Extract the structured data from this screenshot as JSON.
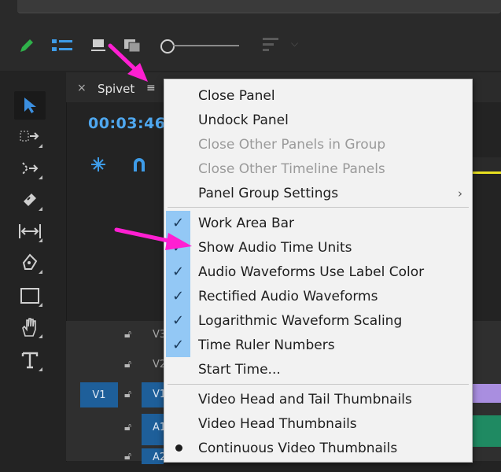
{
  "panel": {
    "tab_label": "Spivet",
    "close_glyph": "×",
    "menu_glyph": "≡",
    "timecode": "00:03:46:"
  },
  "tracks": [
    {
      "name": "V3",
      "selected": false
    },
    {
      "name": "V2",
      "selected": false
    },
    {
      "name": "V1",
      "source_label": "V1",
      "selected": true
    },
    {
      "name": "A1",
      "selected": true
    },
    {
      "name": "A2",
      "selected": true
    }
  ],
  "menu": {
    "items": [
      {
        "label": "Close Panel",
        "enabled": true
      },
      {
        "label": "Undock Panel",
        "enabled": true
      },
      {
        "label": "Close Other Panels in Group",
        "enabled": false
      },
      {
        "label": "Close Other Timeline Panels",
        "enabled": false
      },
      {
        "label": "Panel Group Settings",
        "enabled": true,
        "submenu": true
      },
      {
        "label": "Work Area Bar",
        "checked": true
      },
      {
        "label": "Show Audio Time Units",
        "checked": true
      },
      {
        "label": "Audio Waveforms Use Label Color",
        "checked": true
      },
      {
        "label": "Rectified Audio Waveforms",
        "checked": true
      },
      {
        "label": "Logarithmic Waveform Scaling",
        "checked": true
      },
      {
        "label": "Time Ruler Numbers",
        "checked": true
      },
      {
        "label": "Start Time...",
        "enabled": true
      },
      {
        "label": "Video Head and Tail Thumbnails",
        "enabled": true
      },
      {
        "label": "Video Head Thumbnails",
        "enabled": true
      },
      {
        "label": "Continuous Video Thumbnails",
        "radio_selected": true
      }
    ],
    "submenu_glyph": "›",
    "check_glyph": "✓"
  },
  "annotations": {
    "arrow_color": "#ff1fd2"
  },
  "colors": {
    "accent_blue": "#4fa8f0",
    "track_target": "#1e5f9a",
    "check_highlight": "#93c8f5"
  }
}
